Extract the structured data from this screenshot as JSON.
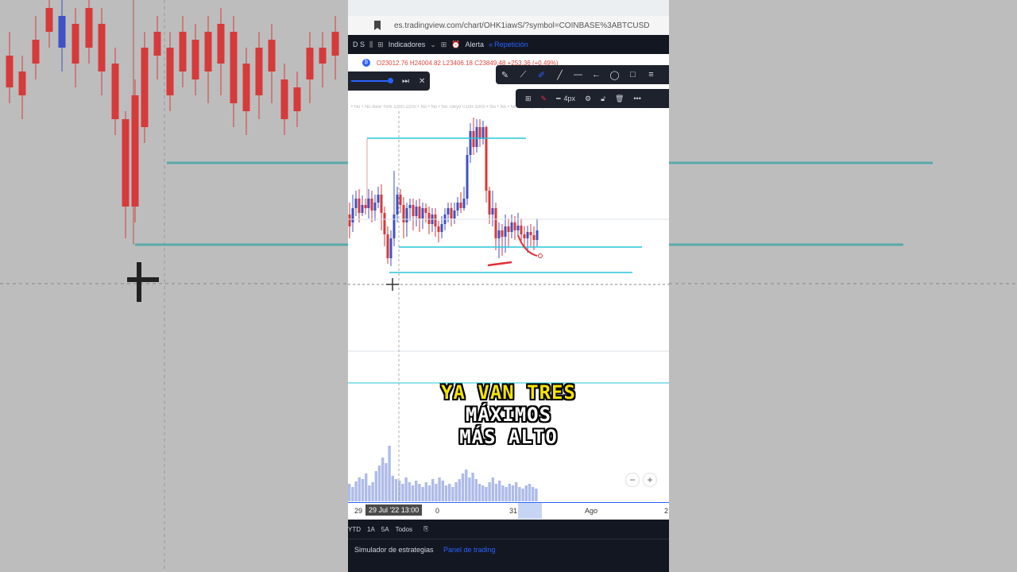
{
  "browser": {
    "url": "es.tradingview.com/chart/OHK1iawS/?symbol=COINBASE%3ABTCUSD"
  },
  "tv_toolbar": {
    "interval": "D S",
    "indicators_label": "Indicadores",
    "alert_label": "Alerta",
    "replay_label": "Repetición"
  },
  "ohlc": {
    "logo": "₿",
    "text": "O23012.76 H24004.82 L23406.18 C23849.48 +253.36 (+0.49%)"
  },
  "toolbar2": {
    "width_label": "4px"
  },
  "sessions_text": "• No • No New York 1300-2200 • No • No • No Tokyo 0100-1000 • No • No • No • No Sydney • No • No • No • No Asia • No • No Session",
  "caption": {
    "line1": "YA VAN TRES",
    "line2": "MÁXIMOS",
    "line3": "MÁS ALTO"
  },
  "zoom": {
    "minus": "−",
    "plus": "+"
  },
  "xaxis": {
    "labels": [
      "29",
      "0",
      "31",
      "Ago",
      "2"
    ],
    "cursor_label": "29 Jul '22  13:00"
  },
  "bottom_bar": {
    "ranges": [
      "YTD",
      "1A",
      "5A",
      "Todos"
    ]
  },
  "panel_tabs": {
    "strategy_tester": "Simulador de estrategias",
    "trading_panel": "Panel de trading"
  },
  "colors": {
    "up_candle": "#3f51c4",
    "down_candle": "#d63a3a",
    "level_line": "#26c6da",
    "caption_yellow": "#f5e400",
    "tv_dark": "#131722",
    "accent": "#2962ff"
  }
}
